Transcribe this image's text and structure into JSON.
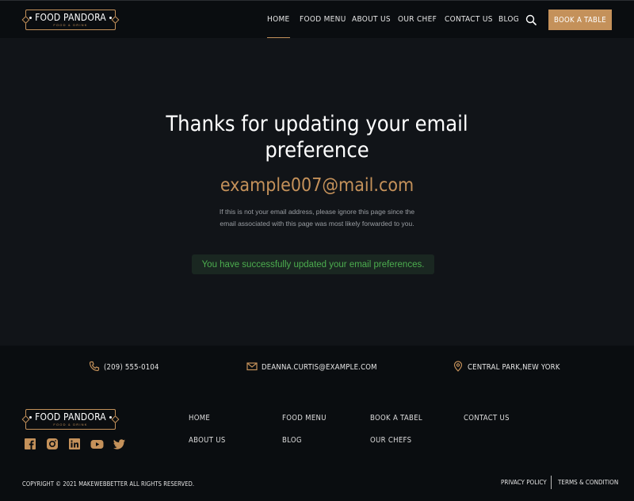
{
  "brand": {
    "name": "FOOD PANDORA",
    "tagline": "FOOD & DRINK"
  },
  "nav": {
    "items": [
      {
        "label": "HOME",
        "active": true
      },
      {
        "label": "FOOD MENU",
        "active": false
      },
      {
        "label": "ABOUT US",
        "active": false
      },
      {
        "label": "OUR CHEF",
        "active": false
      },
      {
        "label": "CONTACT US",
        "active": false
      },
      {
        "label": "BLOG",
        "active": false
      }
    ],
    "search_icon": "search-icon",
    "cta_label": "BOOK A TABLE"
  },
  "main": {
    "title": "Thanks for updating your email preference",
    "email": "example007@mail.com",
    "note": "If this is not your email address, please ignore this page since the email associated with this page was most likely forwarded to you.",
    "success_message": "You have successfully updated your email preferences."
  },
  "contact": {
    "phone": "(209) 555-0104",
    "email": "DEANNA.CURTIS@EXAMPLE.COM",
    "address": "CENTRAL PARK,NEW YORK"
  },
  "footer": {
    "links": [
      {
        "label": "HOME"
      },
      {
        "label": "FOOD MENU"
      },
      {
        "label": "BOOK A TABEL"
      },
      {
        "label": "CONTACT US"
      },
      {
        "label": "ABOUT US"
      },
      {
        "label": "BLOG"
      },
      {
        "label": "OUR CHEFS"
      }
    ],
    "social_icons": [
      "facebook-icon",
      "instagram-icon",
      "linkedin-icon",
      "youtube-icon",
      "twitter-icon"
    ],
    "copyright": "COPYRIGHT © 2021 MAKEWEBBETTER ALL RIGHTS RESERVED.",
    "privacy_label": "PRIVACY POLICY",
    "terms_label": "TERMS & CONDITION"
  },
  "colors": {
    "accent": "#c4915a",
    "background": "#111418",
    "header_bg": "#0a0d10",
    "success_text": "#4cae4f",
    "success_bg": "#1a2721"
  }
}
